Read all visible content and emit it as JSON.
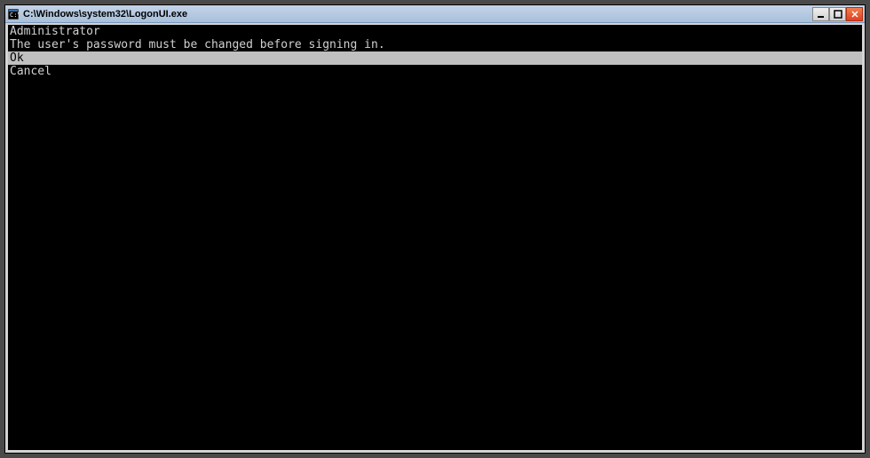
{
  "window": {
    "title": "C:\\Windows\\system32\\LogonUI.exe"
  },
  "console": {
    "username": "Administrator",
    "message": "The user's password must be changed before signing in.",
    "ok": "Ok",
    "cancel": "Cancel"
  }
}
